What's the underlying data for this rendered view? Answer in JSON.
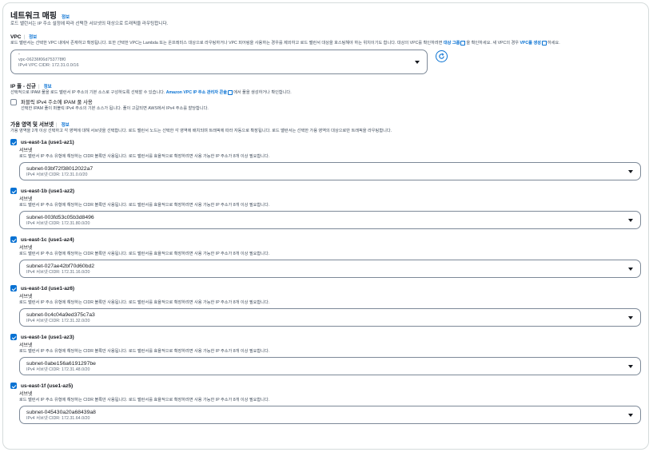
{
  "header": {
    "title": "네트워크 매핑",
    "info": "정보",
    "description": "로드 밸런서는 IP 주소 설정에 따라 선택한 서브넷의 대상으로 트래픽을 라우팅합니다."
  },
  "vpc": {
    "label": "VPC",
    "info": "정보",
    "description_prefix": "로드 밸런서는 선택한 VPC 내에서 존재하고 확장됩니다. 또한 선택한 VPC는 Lambda 또는 온프레미스 대상으로 라우팅하거나 VPC 피어링을 사용하는 경우를 제외하고 로드 밸런서 대상을 호스팅해야 하는 위치이기도 합니다. 대상의 VPC를 확인하려면",
    "target_group_link": "대상 그룹",
    "description_middle": "을 확인하세요. 새 VPC의 경우",
    "create_vpc_link": "VPC를 생성",
    "description_suffix": "하세요.",
    "selected_tag": "-",
    "selected_id": "vpc-06236f06d753778f0",
    "selected_cidr": "IPv4 VPC CIDR: 172.31.0.0/16"
  },
  "ip_pool": {
    "label": "IP 풀 - 신규",
    "info": "정보",
    "description_prefix": "선택적으로 IPAM 풀을 로드 밸런서 IP 주소의 기본 소스로 구성하도록 선택할 수 있습니다.",
    "ipam_link": "Amazon VPC IP 주소 관리자 콘솔",
    "description_suffix": "에서 풀을 생성하거나 확인합니다.",
    "checkbox_label": "퍼블릭 IPv4 주소에 IPAM 풀 사용",
    "checkbox_description": "선택한 IPAM 풀이 퍼블릭 IPv4 주소의 기본 소스가 됩니다. 풀이 고갈되면 AWS에서 IPv4 주소를 할당합니다."
  },
  "zones_section": {
    "label": "가용 영역 및 서브넷",
    "info": "정보",
    "description": "가용 영역을 2개 이상 선택하고 각 영역에 대해 서브넷을 선택합니다. 로드 밸런서 노드는 선택한 각 영역에 배치되며 트래픽에 따라 자동으로 확장됩니다. 로드 밸런서는 선택한 가용 영역의 대상으로만 트래픽을 라우팅합니다."
  },
  "subnet_label": "서브넷",
  "subnet_help": "로드 밸런서 IP 주소 유형에 해당하는 CIDR 블록만 사용됩니다. 로드 밸런서를 효율적으로 확장하려면 사용 가능한 IP 주소가 8개 이상 필요합니다.",
  "zones": [
    {
      "name": "us-east-1a (use1-az1)",
      "subnet_id": "subnet-03bf72f38012022a7",
      "cidr": "IPv4 서브넷 CIDR: 172.31.0.0/20"
    },
    {
      "name": "us-east-1b (use1-az2)",
      "subnet_id": "subnet-003fd53c05b3d8496",
      "cidr": "IPv4 서브넷 CIDR: 172.31.80.0/20"
    },
    {
      "name": "us-east-1c (use1-az4)",
      "subnet_id": "subnet-027ae42bf70d60bd2",
      "cidr": "IPv4 서브넷 CIDR: 172.31.16.0/20"
    },
    {
      "name": "us-east-1d (use1-az6)",
      "subnet_id": "subnet-0c4c04a9ed375c7a3",
      "cidr": "IPv4 서브넷 CIDR: 172.31.32.0/20"
    },
    {
      "name": "us-east-1e (use1-az3)",
      "subnet_id": "subnet-0abe156a6191297be",
      "cidr": "IPv4 서브넷 CIDR: 172.31.48.0/20"
    },
    {
      "name": "us-east-1f (use1-az5)",
      "subnet_id": "subnet-045430a20a68439a8",
      "cidr": "IPv4 서브넷 CIDR: 172.31.64.0/20"
    }
  ],
  "colors": {
    "accent": "#0972d3",
    "border": "#7d8998",
    "muted": "#5f6b7a"
  },
  "icons": {
    "refresh": "refresh-icon",
    "caret": "caret-down-icon",
    "external": "external-link-icon"
  }
}
